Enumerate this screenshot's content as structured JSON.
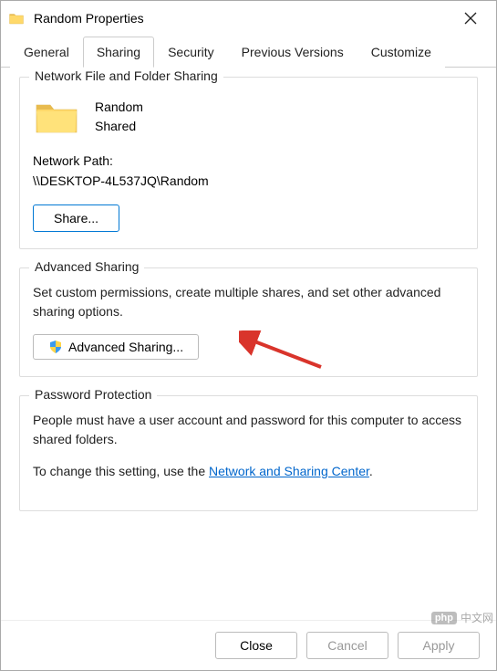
{
  "window": {
    "title": "Random Properties"
  },
  "tabs": {
    "items": [
      {
        "label": "General"
      },
      {
        "label": "Sharing"
      },
      {
        "label": "Security"
      },
      {
        "label": "Previous Versions"
      },
      {
        "label": "Customize"
      }
    ],
    "active_index": 1
  },
  "network_sharing": {
    "title": "Network File and Folder Sharing",
    "folder_name": "Random",
    "status": "Shared",
    "path_label": "Network Path:",
    "path_value": "\\\\DESKTOP-4L537JQ\\Random",
    "share_button": "Share..."
  },
  "advanced_sharing": {
    "title": "Advanced Sharing",
    "description": "Set custom permissions, create multiple shares, and set other advanced sharing options.",
    "button": "Advanced Sharing..."
  },
  "password_protection": {
    "title": "Password Protection",
    "description": "People must have a user account and password for this computer to access shared folders.",
    "change_prefix": "To change this setting, use the ",
    "link_text": "Network and Sharing Center",
    "change_suffix": "."
  },
  "footer": {
    "close": "Close",
    "cancel": "Cancel",
    "apply": "Apply"
  },
  "watermark": {
    "logo": "php",
    "text": "中文网"
  }
}
